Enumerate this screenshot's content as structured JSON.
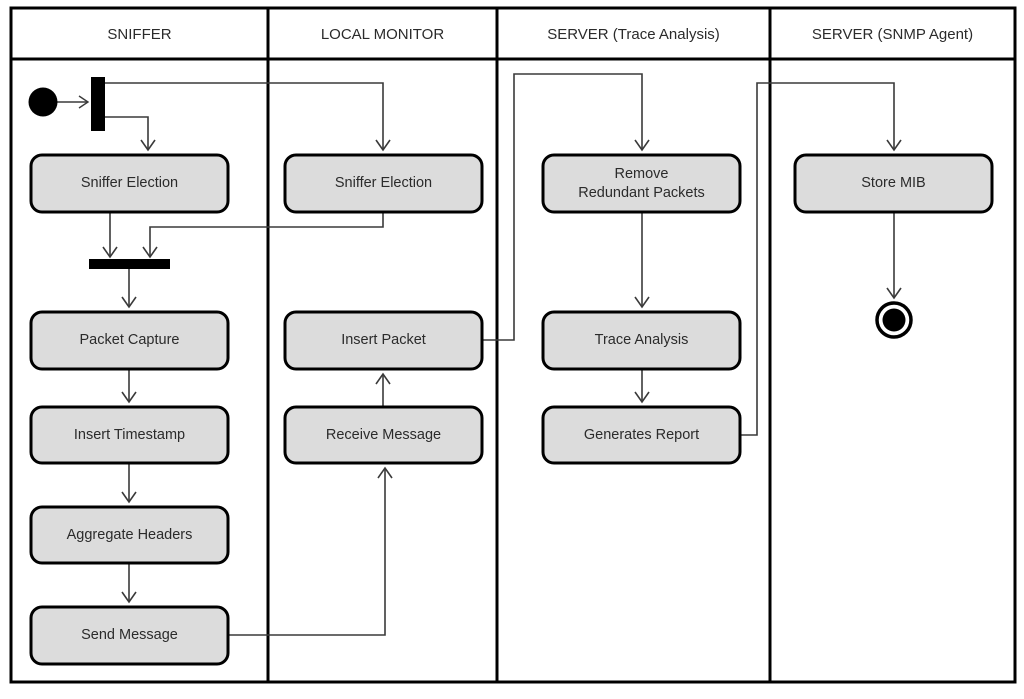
{
  "diagram": {
    "type": "uml-activity-swimlane",
    "colors": {
      "lane_border": "#000000",
      "node_fill": "#DCDCDC",
      "node_border": "#000000",
      "flow_line": "#3a3a3a",
      "background": "#FFFFFF",
      "text": "#2b2b2b"
    }
  },
  "lanes": [
    {
      "id": "sniffer",
      "title": "SNIFFER"
    },
    {
      "id": "local_monitor",
      "title": "LOCAL MONITOR"
    },
    {
      "id": "server_trace",
      "title": "SERVER (Trace Analysis)"
    },
    {
      "id": "server_snmp",
      "title": "SERVER (SNMP Agent)"
    }
  ],
  "nodes": {
    "initial": {
      "kind": "initial-node",
      "lane": "sniffer"
    },
    "fork": {
      "kind": "fork-bar",
      "lane": "sniffer"
    },
    "join": {
      "kind": "join-bar",
      "lane": "sniffer"
    },
    "sniffer_election_a": {
      "kind": "action",
      "lane": "sniffer",
      "label": "Sniffer Election"
    },
    "packet_capture": {
      "kind": "action",
      "lane": "sniffer",
      "label": "Packet Capture"
    },
    "insert_timestamp": {
      "kind": "action",
      "lane": "sniffer",
      "label": "Insert Timestamp"
    },
    "aggregate_headers": {
      "kind": "action",
      "lane": "sniffer",
      "label": "Aggregate Headers"
    },
    "send_message": {
      "kind": "action",
      "lane": "sniffer",
      "label": "Send Message"
    },
    "sniffer_election_b": {
      "kind": "action",
      "lane": "local_monitor",
      "label": "Sniffer Election"
    },
    "insert_packet": {
      "kind": "action",
      "lane": "local_monitor",
      "label": "Insert Packet"
    },
    "receive_message": {
      "kind": "action",
      "lane": "local_monitor",
      "label": "Receive Message"
    },
    "remove_redundant": {
      "kind": "action",
      "lane": "server_trace",
      "label_line1": "Remove",
      "label_line2": "Redundant Packets"
    },
    "trace_analysis": {
      "kind": "action",
      "lane": "server_trace",
      "label": "Trace Analysis"
    },
    "generates_report": {
      "kind": "action",
      "lane": "server_trace",
      "label": "Generates Report"
    },
    "store_mib": {
      "kind": "action",
      "lane": "server_snmp",
      "label": "Store MIB"
    },
    "final": {
      "kind": "final-node",
      "lane": "server_snmp"
    }
  },
  "flows": [
    {
      "from": "initial",
      "to": "fork"
    },
    {
      "from": "fork",
      "to": "sniffer_election_a"
    },
    {
      "from": "fork",
      "to": "sniffer_election_b"
    },
    {
      "from": "sniffer_election_a",
      "to": "join"
    },
    {
      "from": "sniffer_election_b",
      "to": "join"
    },
    {
      "from": "join",
      "to": "packet_capture"
    },
    {
      "from": "packet_capture",
      "to": "insert_timestamp"
    },
    {
      "from": "insert_timestamp",
      "to": "aggregate_headers"
    },
    {
      "from": "aggregate_headers",
      "to": "send_message"
    },
    {
      "from": "send_message",
      "to": "receive_message"
    },
    {
      "from": "receive_message",
      "to": "insert_packet"
    },
    {
      "from": "insert_packet",
      "to": "remove_redundant"
    },
    {
      "from": "remove_redundant",
      "to": "trace_analysis"
    },
    {
      "from": "trace_analysis",
      "to": "generates_report"
    },
    {
      "from": "generates_report",
      "to": "store_mib"
    },
    {
      "from": "store_mib",
      "to": "final"
    }
  ]
}
